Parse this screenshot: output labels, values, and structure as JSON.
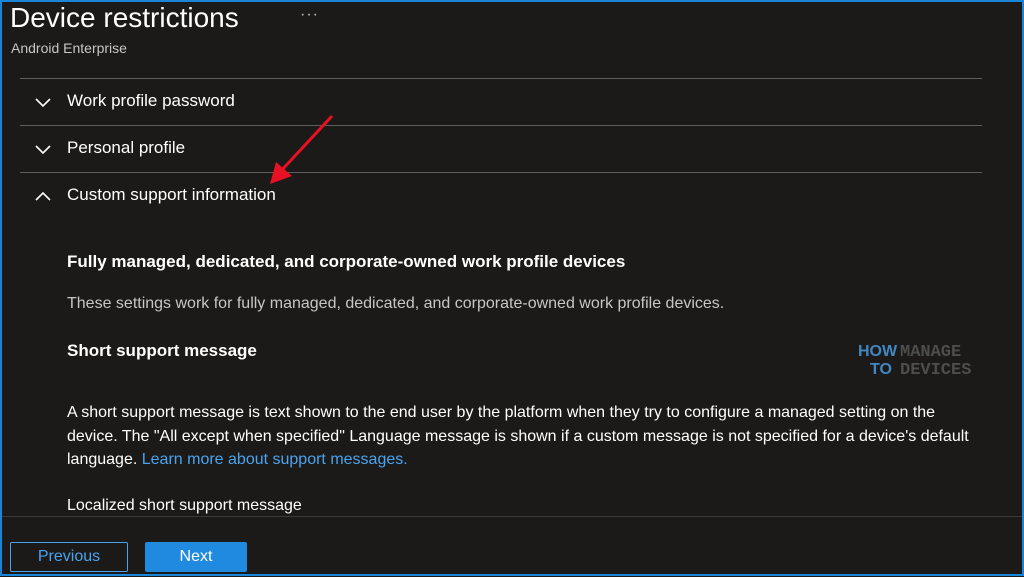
{
  "header": {
    "title": "Device restrictions",
    "more_label": "···",
    "subtitle": "Android Enterprise"
  },
  "sections": [
    {
      "label": "Work profile password",
      "expanded": false
    },
    {
      "label": "Personal profile",
      "expanded": false
    },
    {
      "label": "Custom support information",
      "expanded": true
    }
  ],
  "content": {
    "heading": "Fully managed, dedicated, and corporate-owned work profile devices",
    "description": "These settings work for fully managed, dedicated, and corporate-owned work profile devices.",
    "short_heading": "Short support message",
    "body": "A short support message is text shown to the end user by the platform when they try to configure a managed setting on the device. The \"All except when specified\" Language message is shown if a custom message is not specified for a device's default language.",
    "link": "Learn more about support messages.",
    "localized_label": "Localized short support message"
  },
  "watermark": {
    "how": "HOW",
    "to": "TO",
    "manage": "MANAGE",
    "devices": "DEVICES"
  },
  "footer": {
    "previous_label": "Previous",
    "next_label": "Next"
  },
  "colors": {
    "accent": "#1f8ae0",
    "link": "#4aa3ef",
    "annotation_arrow": "#e81123"
  }
}
